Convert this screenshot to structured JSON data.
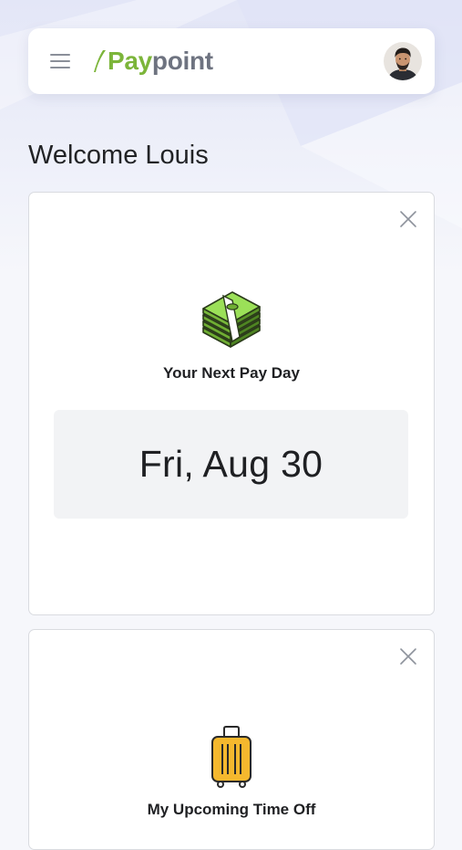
{
  "header": {
    "logo_pay": "Pay",
    "logo_point": "point",
    "menu_icon": "hamburger-menu-icon",
    "avatar": "user-avatar"
  },
  "welcome": {
    "text": "Welcome Louis"
  },
  "cards": [
    {
      "icon": "money-stack-icon",
      "title": "Your Next Pay Day",
      "value": "Fri, Aug 30",
      "close_icon": "close-icon"
    },
    {
      "icon": "suitcase-icon",
      "title": "My Upcoming Time Off",
      "close_icon": "close-icon"
    }
  ],
  "colors": {
    "brand_green": "#7cb53a",
    "brand_gray": "#6e7380",
    "suitcase_yellow": "#f5b82e"
  }
}
